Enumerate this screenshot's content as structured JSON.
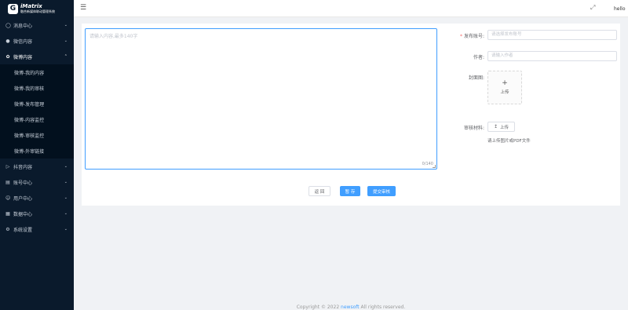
{
  "app": {
    "logo_mark": "G",
    "logo_title": "iMatrix",
    "logo_subtitle": "融合新媒体联动管理系统"
  },
  "sidebar": {
    "items": [
      {
        "label": "消息中心",
        "icon": "bell-icon"
      },
      {
        "label": "微信内容",
        "icon": "wechat-icon"
      },
      {
        "label": "微博内容",
        "icon": "weibo-icon",
        "open": true,
        "children": [
          "微博-我的内容",
          "微博-我的审核",
          "微博-发布管理",
          "微博-内容监控",
          "微博-审核监控",
          "微博-外审链接"
        ]
      },
      {
        "label": "抖音内容",
        "icon": "video-icon"
      },
      {
        "label": "账号中心",
        "icon": "document-icon"
      },
      {
        "label": "用户中心",
        "icon": "users-icon"
      },
      {
        "label": "数据中心",
        "icon": "chart-icon"
      },
      {
        "label": "系统设置",
        "icon": "gear-icon"
      }
    ]
  },
  "header": {
    "user_name": "hello"
  },
  "editor": {
    "placeholder": "请输入内容,最多140字",
    "counter": "0/140"
  },
  "form": {
    "account_label": "发布账号:",
    "account_placeholder": "请选择发布账号",
    "author_label": "作者:",
    "author_placeholder": "请输入作者",
    "cover_label": "封面图:",
    "cover_upload_text": "上传",
    "material_label": "审核材料:",
    "material_upload_text": "上传",
    "material_tip": "请上传图片或PDF文件"
  },
  "actions": {
    "back": "返 回",
    "save": "暂 存",
    "submit": "提交审核"
  },
  "footer": {
    "copyright": "Copyright © 2022 ",
    "company": "newsoft",
    "rights": " All rights reserved."
  },
  "colors": {
    "sidebar_bg": "#0a1a2c",
    "primary": "#409eff",
    "page_bg": "#f0f2f5"
  }
}
